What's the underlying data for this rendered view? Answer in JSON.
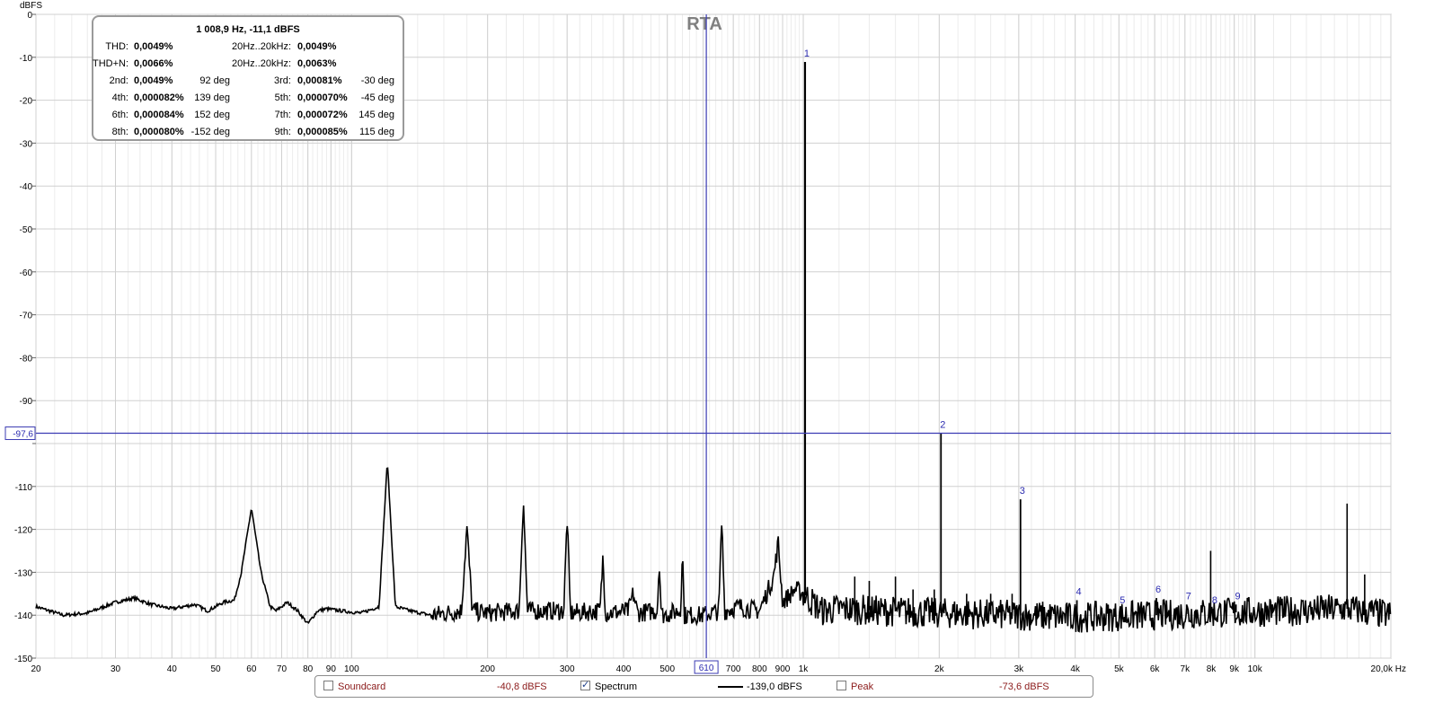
{
  "chart_data": {
    "type": "line",
    "title": "RTA",
    "ylabel": "dBFS",
    "xlabel": "Hz",
    "x_scale": "log",
    "xlim": [
      20,
      20000
    ],
    "ylim": [
      -150,
      0
    ],
    "y_ticks": [
      0,
      -10,
      -20,
      -30,
      -40,
      -50,
      -60,
      -70,
      -80,
      -90,
      -100,
      -110,
      -120,
      -130,
      -140,
      -150
    ],
    "y_tick_labels": [
      "0",
      "-10",
      "-20",
      "-30",
      "-40",
      "-50",
      "-60",
      "-70",
      "-80",
      "-90",
      "",
      "-110",
      "-120",
      "-130",
      "-140",
      "-150"
    ],
    "x_major_ticks": [
      20,
      30,
      40,
      50,
      60,
      70,
      80,
      90,
      100,
      200,
      300,
      400,
      500,
      600,
      700,
      800,
      900,
      1000,
      2000,
      3000,
      4000,
      5000,
      6000,
      7000,
      8000,
      9000,
      10000,
      20000
    ],
    "x_tick_labels": [
      "20",
      "30",
      "40",
      "50",
      "60",
      "70",
      "80",
      "90",
      "100",
      "200",
      "300",
      "400",
      "500",
      "",
      "700",
      "800",
      "900",
      "1k",
      "2k",
      "3k",
      "4k",
      "5k",
      "6k",
      "7k",
      "8k",
      "9k",
      "10k",
      "20,0k Hz"
    ],
    "grid": true,
    "cursor": {
      "x_label": "610",
      "x_value": 610,
      "y_label": "-97,6",
      "y_value": -97.6
    },
    "series": [
      {
        "name": "Spectrum",
        "noise_floor_points": [
          [
            20,
            -138
          ],
          [
            23,
            -140
          ],
          [
            26,
            -139.5
          ],
          [
            30,
            -137
          ],
          [
            33,
            -136
          ],
          [
            36,
            -137.5
          ],
          [
            40,
            -138.5
          ],
          [
            45,
            -137.5
          ],
          [
            48,
            -139
          ],
          [
            52,
            -137
          ],
          [
            55,
            -136.5
          ],
          [
            57,
            -130
          ],
          [
            60,
            -115
          ],
          [
            63,
            -130
          ],
          [
            66,
            -138
          ],
          [
            68,
            -139
          ],
          [
            72,
            -137
          ],
          [
            76,
            -139
          ],
          [
            80,
            -142
          ],
          [
            84,
            -139
          ],
          [
            88,
            -138.5
          ],
          [
            95,
            -139
          ],
          [
            105,
            -139.5
          ],
          [
            115,
            -138
          ],
          [
            120,
            -104
          ],
          [
            125,
            -138
          ],
          [
            135,
            -139
          ],
          [
            150,
            -140
          ],
          [
            175,
            -139
          ],
          [
            180,
            -119.5
          ],
          [
            185,
            -139
          ],
          [
            200,
            -139.5
          ],
          [
            235,
            -139
          ],
          [
            240,
            -112.5
          ],
          [
            245,
            -139
          ],
          [
            295,
            -139
          ],
          [
            300,
            -117
          ],
          [
            305,
            -139.5
          ],
          [
            355,
            -139
          ],
          [
            360,
            -126.5
          ],
          [
            365,
            -139.5
          ],
          [
            410,
            -139
          ],
          [
            420,
            -135
          ],
          [
            430,
            -139.5
          ],
          [
            475,
            -139
          ],
          [
            480,
            -127
          ],
          [
            485,
            -140
          ],
          [
            535,
            -139
          ],
          [
            540,
            -124
          ],
          [
            545,
            -140
          ],
          [
            600,
            -140
          ],
          [
            650,
            -139
          ],
          [
            660,
            -118
          ],
          [
            670,
            -139
          ],
          [
            720,
            -138
          ],
          [
            800,
            -139
          ],
          [
            860,
            -131
          ],
          [
            880,
            -123
          ],
          [
            900,
            -137
          ],
          [
            960,
            -134
          ],
          [
            1000,
            -135
          ],
          [
            1100,
            -139
          ],
          [
            1200,
            -138.5
          ],
          [
            1500,
            -139
          ],
          [
            2000,
            -139.5
          ],
          [
            3000,
            -140
          ],
          [
            4000,
            -140.5
          ],
          [
            6000,
            -140
          ],
          [
            8000,
            -139.5
          ],
          [
            12000,
            -139
          ],
          [
            16000,
            -138.5
          ],
          [
            20000,
            -140
          ]
        ],
        "peaks": [
          {
            "f": 1008.9,
            "db": -11.1,
            "label": "1"
          },
          {
            "f": 2017.8,
            "db": -97.6,
            "label": "2"
          },
          {
            "f": 3026.7,
            "db": -113,
            "label": "3"
          },
          {
            "f": 4035.6,
            "db": -136.5,
            "label": "4"
          },
          {
            "f": 5044.5,
            "db": -138.5,
            "label": "5"
          },
          {
            "f": 6053.4,
            "db": -136,
            "label": "6"
          },
          {
            "f": 7062.3,
            "db": -137.5,
            "label": "7"
          },
          {
            "f": 8071.2,
            "db": -138.5,
            "label": "8"
          },
          {
            "f": 9080.1,
            "db": -137.5,
            "label": "9"
          }
        ],
        "spurs": [
          {
            "f": 7980,
            "db": -125
          },
          {
            "f": 16000,
            "db": -114
          },
          {
            "f": 17500,
            "db": -130.5
          },
          {
            "f": 1300,
            "db": -131
          },
          {
            "f": 1400,
            "db": -132
          },
          {
            "f": 1600,
            "db": -131
          },
          {
            "f": 1750,
            "db": -134
          },
          {
            "f": 1950,
            "db": -134
          },
          {
            "f": 2300,
            "db": -135
          },
          {
            "f": 2600,
            "db": -135
          },
          {
            "f": 2900,
            "db": -135
          }
        ]
      }
    ],
    "harmonic_table": {
      "header": "1 008,9 Hz, -11,1 dBFS",
      "thd_label": "THD:",
      "thd_value": "0,0049%",
      "thd_band_label": "20Hz..20kHz:",
      "thd_band_value": "0,0049%",
      "thdn_label": "THD+N:",
      "thdn_value": "0,0066%",
      "thdn_band_label": "20Hz..20kHz:",
      "thdn_band_value": "0,0063%",
      "harmonics": [
        {
          "name": "2nd:",
          "value": "0,0049%",
          "phase": "92 deg"
        },
        {
          "name": "3rd:",
          "value": "0,00081%",
          "phase": "-30 deg"
        },
        {
          "name": "4th:",
          "value": "0,000082%",
          "phase": "139 deg"
        },
        {
          "name": "5th:",
          "value": "0,000070%",
          "phase": "-45 deg"
        },
        {
          "name": "6th:",
          "value": "0,000084%",
          "phase": "152 deg"
        },
        {
          "name": "7th:",
          "value": "0,000072%",
          "phase": "145 deg"
        },
        {
          "name": "8th:",
          "value": "0,000080%",
          "phase": "-152 deg"
        },
        {
          "name": "9th:",
          "value": "0,000085%",
          "phase": "115 deg"
        }
      ]
    }
  },
  "legend": {
    "soundcard_label": "Soundcard",
    "soundcard_value": "-40,8 dBFS",
    "soundcard_checked": false,
    "spectrum_label": "Spectrum",
    "spectrum_value": "-139,0 dBFS",
    "spectrum_checked": true,
    "peak_label": "Peak",
    "peak_value": "-73,6 dBFS",
    "peak_checked": false
  },
  "colors": {
    "grid": "#d6d6d6",
    "cursor": "#3b3bb3",
    "trace": "#000000",
    "title": "#808080",
    "marker": "#2b2bb0",
    "legend_value": "#8b1a1a"
  }
}
